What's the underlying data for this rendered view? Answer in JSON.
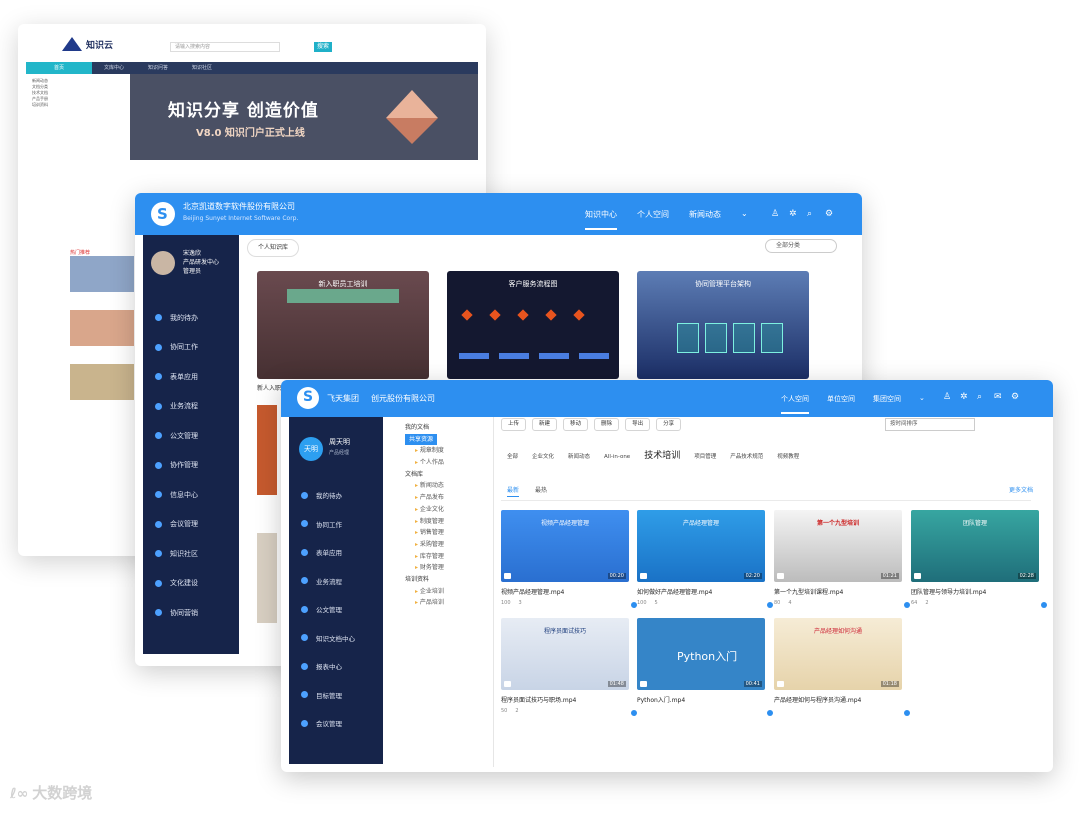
{
  "back_window": {
    "logo": "知识云",
    "search_placeholder": "请输入搜索内容",
    "search_button": "搜索",
    "nav": [
      "首页",
      "文库中心",
      "知识问答",
      "知识社区"
    ],
    "left_menu": [
      "新闻动态",
      "文档分类",
      "技术文档",
      "产品手册",
      "培训资料"
    ],
    "banner_title": "知识分享  创造价值",
    "banner_sub": "V8.0  知识门户正式上线",
    "red_link": "热门推荐"
  },
  "middle_window": {
    "company_name": "北京凯道数字软件股份有限公司",
    "company_en": "Beijing Sunyet Internet Software Corp.",
    "nav": [
      "知识中心",
      "个人空间",
      "新闻动态"
    ],
    "user_name": "宋逸欣",
    "user_dept": "产品研发中心",
    "user_role": "管理员",
    "menu": [
      "我的待办",
      "协同工作",
      "表单应用",
      "业务流程",
      "公文管理",
      "协作管理",
      "信息中心",
      "会议管理",
      "知识社区",
      "文化建设",
      "协同营销"
    ],
    "breadcrumb": "个人知识库",
    "select_label": "全部分类",
    "cards": [
      "新入职员工培训",
      "客户服务流程图",
      "协同管理平台架构"
    ],
    "below_text": "新人入职"
  },
  "front_window": {
    "group_name": "飞天集团",
    "company": "创元股份有限公司",
    "nav": [
      "个人空间",
      "单位空间",
      "集团空间"
    ],
    "avatar_text": "天明",
    "user_name": "周天明",
    "user_role": "产品经理",
    "menu": [
      "我的待办",
      "协同工作",
      "表单应用",
      "业务流程",
      "公文管理",
      "知识文档中心",
      "报表中心",
      "目标管理",
      "会议管理"
    ],
    "tree": {
      "root1": "我的文档",
      "selected": "共享资源",
      "root1_children": [
        "规章制度",
        "个人作品"
      ],
      "root2": "文档库",
      "root2_children": [
        "新闻动态",
        "产品发布",
        "企业文化",
        "制度管理",
        "销售管理",
        "采购管理",
        "库存管理",
        "财务管理"
      ],
      "root3": "培训资料",
      "root3_children": [
        "企业培训",
        "产品培训"
      ]
    },
    "toolbar": [
      "上传",
      "新建",
      "移动",
      "删除",
      "导出",
      "分享"
    ],
    "sort_label": "按时间排序",
    "categories": [
      "全部",
      "企业文化",
      "新闻动态",
      "All-in-one",
      "技术培训",
      "项目管理",
      "产品技术规范",
      "视频教程"
    ],
    "active_category": "技术培训",
    "subtabs": [
      "最新",
      "最热"
    ],
    "more_link": "更多文档",
    "videos": [
      {
        "file": "视频产品经理管理.mp4",
        "views": "100",
        "likes": "3",
        "duration": "00:20",
        "overlay": "视频产品经理管理"
      },
      {
        "file": "如何做好产品经理管理.mp4",
        "views": "100",
        "likes": "5",
        "duration": "02:20",
        "overlay": "产品经理管理"
      },
      {
        "file": "第一个九型培训课程.mp4",
        "views": "80",
        "likes": "4",
        "duration": "01:21",
        "overlay": "第一个九型培训"
      },
      {
        "file": "团队管理与领导力培训.mp4",
        "views": "64",
        "likes": "2",
        "duration": "02:28",
        "overlay": "团队管理"
      },
      {
        "file": "程序员面试技巧与职场.mp4",
        "views": "50",
        "likes": "2",
        "duration": "01:48",
        "overlay": "程序员面试技巧"
      },
      {
        "file": "Python入门.mp4",
        "views": "",
        "likes": "",
        "duration": "00:41",
        "overlay": "Python入门"
      },
      {
        "file": "产品经理如何与程序员沟通.mp4",
        "views": "",
        "likes": "",
        "duration": "01:18",
        "overlay": "产品经理如何沟通"
      }
    ]
  },
  "watermark": "大数跨境"
}
